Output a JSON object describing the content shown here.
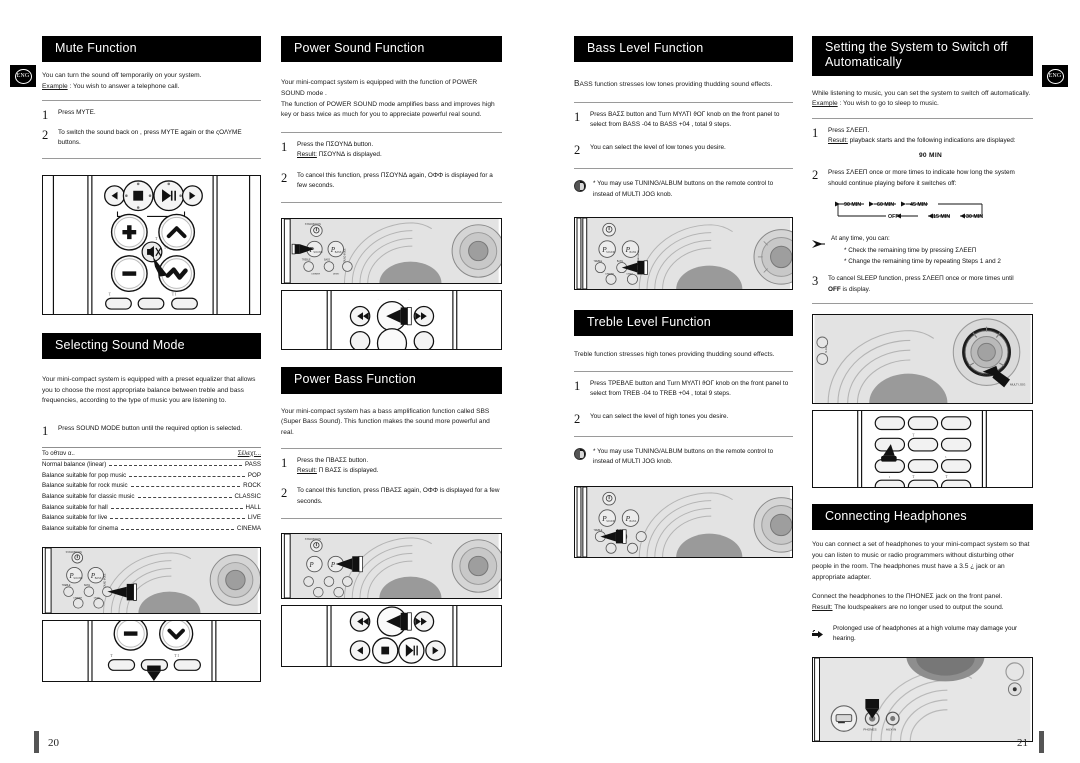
{
  "spread": {
    "left_page_number": "20",
    "right_page_number": "21",
    "language_badge": "ENG"
  },
  "columns": {
    "c1": {
      "mute": {
        "title": "Mute Function",
        "intro_line1": "You can turn the sound off temporarily on your system.",
        "intro_example_label": "Example",
        "intro_example_text": " : You wish to answer a telephone call.",
        "steps": [
          {
            "num": "1",
            "text": "Press ΜΥΤΕ."
          },
          {
            "num": "2",
            "text": "To switch the sound back on , press ΜΥΤΕ again or the ςΟΛΥΜΕ buttons."
          }
        ]
      },
      "remote_illustration": {
        "name": "remote-control-volume-mute",
        "buttons": [
          "prev-track",
          "stop",
          "play-pause",
          "next-track",
          "volume-up",
          "tuning-up",
          "mute",
          "sound-mode",
          "volume-down",
          "tuning-down"
        ]
      },
      "sound_mode": {
        "title": "Selecting  Sound Mode",
        "intro": "Your mini-compact system is equipped with a preset equalizer that allows you to choose the most appropriate balance between treble and bass frequencies, according to the type of music you are listening to.",
        "step_num": "1",
        "step_text": "Press SOUND MODE button until the required option is selected.",
        "table": {
          "header_left": "Το οθταν α..",
          "header_right": "Σέλεχτ...",
          "rows": [
            {
              "desc": "Normal balance (linear)",
              "val": "PASS"
            },
            {
              "desc": "Balance suitable for pop music",
              "val": "POP"
            },
            {
              "desc": "Balance suitable for rock music",
              "val": "ROCK"
            },
            {
              "desc": "Balance suitable for classic music",
              "val": "CLASSIC"
            },
            {
              "desc": "Balance suitable for hall",
              "val": "HALL"
            },
            {
              "desc": "Balance suitable for live",
              "val": "LIVE"
            },
            {
              "desc": "Balance suitable for cinema",
              "val": "CINEMA"
            }
          ]
        }
      },
      "panel_illustration": {
        "name": "front-panel-sound-mode"
      },
      "remote_illustration2": {
        "name": "remote-control-sound-mode-keys"
      }
    },
    "c2": {
      "power_sound": {
        "title": "Power Sound Function",
        "intro": "Your mini-compact system is equipped with the function of POWER SOUND mode .\nThe function of POWER SOUND mode amplifies bass and improves high key or bass twice as much for you to appreciate powerful real sound.",
        "steps": [
          {
            "num": "1",
            "text": "Press the ΠΣΟΥΝΔ button.",
            "result_label": "Result:",
            "result_text": " ΠΣΟΥΝΔ  is displayed."
          },
          {
            "num": "2",
            "text": "To cancel this function, press ΠΣΟΥΝΔ  again,  ΟΦΦ is displayed for a few seconds."
          }
        ]
      },
      "panel_illustration": {
        "name": "front-panel-power-sound"
      },
      "remote_illustration": {
        "name": "remote-control-power-sound"
      },
      "power_bass": {
        "title": "Power Bass Function",
        "intro": "Your mini-compact system has a bass amplification function called SBS (Super Bass Sound). This function makes the sound more powerful and real.",
        "steps": [
          {
            "num": "1",
            "text": "Press the ΠΒΑΣΣ button.",
            "result_label": "Result:",
            "result_text": " Π ΒΑΣΣ  is displayed."
          },
          {
            "num": "2",
            "text": "To cancel this function, press ΠΒΑΣΣ  again,  ΟΦΦ is displayed  for a few seconds."
          }
        ]
      },
      "panel_illustration2": {
        "name": "front-panel-power-bass"
      },
      "remote_illustration2": {
        "name": "remote-control-power-bass"
      }
    },
    "c3": {
      "bass": {
        "title": "Bass Level Function",
        "intro_cap": "B",
        "intro": "ASS function stresses low tones providing thudding sound effects.",
        "steps": [
          {
            "num": "1",
            "text": "Press ΒΑΣΣ  button and Turn ΜΥΛΤΙ ϑΟΓ knob on the front panel to select from BASS -04  to BASS +04  , total 9 steps."
          },
          {
            "num": "2",
            "text": "You can select the level of low tones you desire."
          }
        ],
        "note": "You may use TUNING/ALBUM          buttons on the remote control to instead of MULTI JOG knob.",
        "note_bullet": "*"
      },
      "panel_illustration": {
        "name": "front-panel-bass-level"
      },
      "treble": {
        "title": "Treble Level Function",
        "intro": "Treble function stresses high tones providing thudding sound effects.",
        "steps": [
          {
            "num": "1",
            "text": "Press ΤΡΕΒΛΕ  button and Turn ΜΥΛΤΙ ϑΟΓ knob on the front panel to select from TREB -04  to TREB +04  , total 9 steps."
          },
          {
            "num": "2",
            "text": "You can select the level of high tones you desire."
          }
        ],
        "note": "You may use TUNING/ALBUM          buttons on the remote control to instead of MULTI JOG knob.",
        "note_bullet": "*"
      },
      "panel_illustration2": {
        "name": "front-panel-treble-level"
      }
    },
    "c4": {
      "sleep": {
        "title_line1": "Setting the System to Switch off",
        "title_line2": "Automatically",
        "intro_line1": "While listening to music, you can set the system to switch off automatically.",
        "intro_example_label": "Example",
        "intro_example_text": " : You wish to go to sleep to music.",
        "steps": [
          {
            "num": "1",
            "text": "Press ΣΛΕΕΠ.",
            "result_label": "Result:",
            "result_text": " playback starts and the following indications are displayed:",
            "display": "90 MIN"
          },
          {
            "num": "2",
            "text": "Press ΣΛΕΕΠ once or more times to indicate how long the system should continue playing before it switches off:"
          },
          {
            "num": "3",
            "text": "To cancel SLEEP function, press ΣΛΕΕΠ once or more times until",
            "bold_tail": "OFF",
            "tail_text": " is display."
          }
        ],
        "cycle": [
          "90 MIN",
          "60 MIN",
          "45 MIN",
          "30 MIN",
          "15 MIN",
          "OFF"
        ],
        "anytime_label": "At any time, you can:",
        "anytime_items": [
          "Check the remaining time by pressing ΣΛΕΕΠ",
          "Change the remaining time by repeating Steps 1 and 2"
        ],
        "anytime_bullet": "*"
      },
      "panel_illustration": {
        "name": "front-panel-multi-jog"
      },
      "remote_illustration": {
        "name": "remote-control-sleep-keypad"
      },
      "headphones": {
        "title": "Connecting Headphones",
        "intro": "You can connect a set of headphones to your mini-compact system so that you can listen to music or radio programmers without disturbing other people in the room. The headphones must have a 3.5    ¿ jack or an appropriate adapter.",
        "connect_line": "Connect the headphones to the ΠΗΟΝΕΣ jack on the front panel.",
        "result_label": "Result:",
        "result_text": " The loudspeakers are no longer used to output the sound.",
        "warning": "Prolonged use of headphones at a high volume may damage your hearing."
      },
      "panel_illustration2": {
        "name": "front-panel-phones-jack",
        "labels": [
          "PHONES",
          "AUX IN"
        ]
      }
    }
  }
}
